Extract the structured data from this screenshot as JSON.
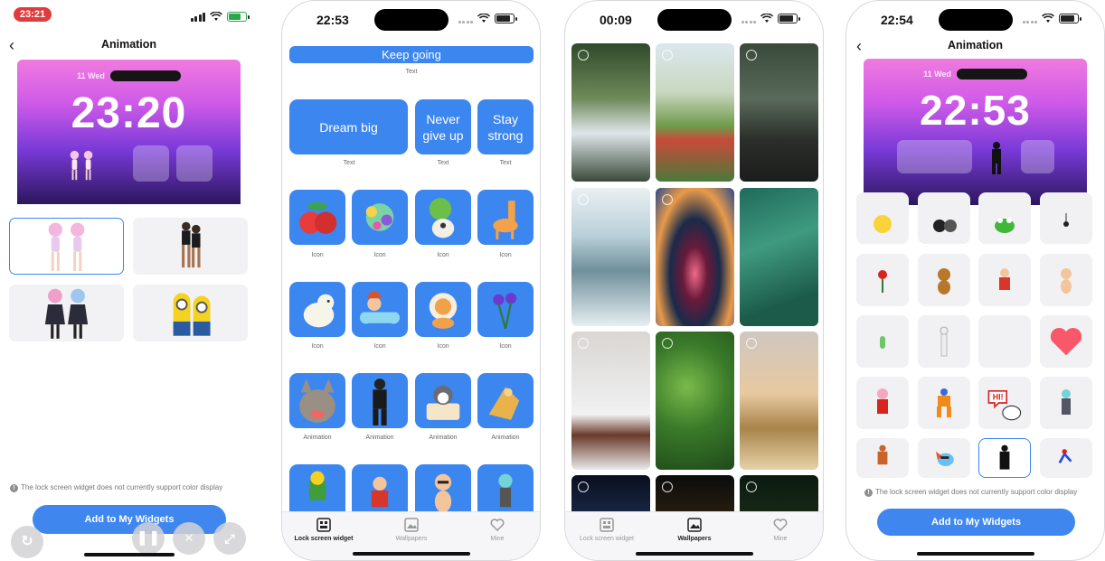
{
  "screen1": {
    "recording_time": "23:21",
    "nav_title": "Animation",
    "lock_date": "11 Wed",
    "lock_time": "23:20",
    "note": "The lock screen widget does not currently support color display",
    "add_button": "Add to My Widgets",
    "anim_options": [
      "anime-dancers",
      "dancing-women",
      "anime-maids",
      "minions"
    ]
  },
  "screen2": {
    "status_time": "22:53",
    "banner_text": "Keep going",
    "banner_label": "Text",
    "text_tiles": [
      {
        "text": "Dream big",
        "label": "Text"
      },
      {
        "text": "Never give up",
        "label": "Text"
      },
      {
        "text": "Stay strong",
        "label": "Text"
      }
    ],
    "icon_label": "Icon",
    "anim_label": "Animation",
    "tabs": [
      "Lock screen widget",
      "Wallpapers",
      "Mine"
    ]
  },
  "screen3": {
    "status_time": "00:09",
    "tabs": [
      "Lock screen widget",
      "Wallpapers",
      "Mine"
    ]
  },
  "screen4": {
    "status_time": "22:54",
    "nav_title": "Animation",
    "lock_date": "11 Wed",
    "lock_time": "22:53",
    "note": "The lock screen widget does not currently support color display",
    "add_button": "Add to My Widgets"
  },
  "colors": {
    "accent": "#3c86f0",
    "recording": "#e23b3b"
  }
}
